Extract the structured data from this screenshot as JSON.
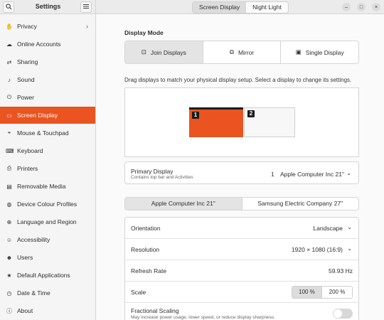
{
  "header": {
    "title": "Settings",
    "tabs": [
      {
        "label": "Screen Display",
        "active": true
      },
      {
        "label": "Night Light",
        "active": false
      }
    ],
    "search_icon": "search-icon",
    "menu_icon": "hamburger-icon",
    "window_controls": {
      "minimize": "–",
      "maximize": "□",
      "close": "×"
    }
  },
  "sidebar": {
    "items": [
      {
        "label": "Privacy",
        "icon": "hand-icon",
        "glyph": "✋",
        "chevron": true
      },
      {
        "label": "Online Accounts",
        "icon": "cloud-icon",
        "glyph": "☁"
      },
      {
        "label": "Sharing",
        "icon": "share-icon",
        "glyph": "⇄"
      },
      {
        "label": "Sound",
        "icon": "music-note-icon",
        "glyph": "♪"
      },
      {
        "label": "Power",
        "icon": "power-icon",
        "glyph": "⏻"
      },
      {
        "label": "Screen Display",
        "icon": "display-icon",
        "glyph": "▭",
        "active": true
      },
      {
        "label": "Mouse & Touchpad",
        "icon": "mouse-icon",
        "glyph": "⌖"
      },
      {
        "label": "Keyboard",
        "icon": "keyboard-icon",
        "glyph": "⌨"
      },
      {
        "label": "Printers",
        "icon": "printer-icon",
        "glyph": "⎙"
      },
      {
        "label": "Removable Media",
        "icon": "media-icon",
        "glyph": "▤"
      },
      {
        "label": "Device Colour Profiles",
        "icon": "color-profile-icon",
        "glyph": "◍"
      },
      {
        "label": "Language and Region",
        "icon": "globe-icon",
        "glyph": "⊕"
      },
      {
        "label": "Accessibility",
        "icon": "accessibility-icon",
        "glyph": "☺"
      },
      {
        "label": "Users",
        "icon": "users-icon",
        "glyph": "☻"
      },
      {
        "label": "Default Applications",
        "icon": "star-icon",
        "glyph": "★"
      },
      {
        "label": "Date & Time",
        "icon": "clock-icon",
        "glyph": "◷"
      },
      {
        "label": "About",
        "icon": "info-icon",
        "glyph": "ⓘ"
      }
    ]
  },
  "main": {
    "display_mode_title": "Display Mode",
    "modes": [
      {
        "label": "Join Displays",
        "icon": "join-displays-icon",
        "glyph": "⊡",
        "active": true
      },
      {
        "label": "Mirror",
        "icon": "mirror-icon",
        "glyph": "⧉",
        "active": false
      },
      {
        "label": "Single Display",
        "icon": "single-display-icon",
        "glyph": "▣",
        "active": false
      }
    ],
    "hint": "Drag displays to match your physical display setup. Select a display to change its settings.",
    "monitors": [
      {
        "number": "1",
        "selected": true
      },
      {
        "number": "2",
        "selected": false
      }
    ],
    "primary_display": {
      "title": "Primary Display",
      "subtitle": "Contains top bar and Activities",
      "number": "1",
      "value": "Apple Computer Inc 21\""
    },
    "display_tabs": [
      {
        "label": "Apple Computer Inc 21\"",
        "active": true
      },
      {
        "label": "Samsung Electric Company 27\"",
        "active": false
      }
    ],
    "settings": {
      "orientation": {
        "label": "Orientation",
        "value": "Landscape"
      },
      "resolution": {
        "label": "Resolution",
        "value": "1920 × 1080 (16:9)"
      },
      "refresh_rate": {
        "label": "Refresh Rate",
        "value": "59.93 Hz"
      },
      "scale": {
        "label": "Scale",
        "options": [
          "100 %",
          "200 %"
        ],
        "selected": "100 %"
      },
      "fractional_scaling": {
        "label": "Fractional Scaling",
        "subtitle": "May increase power usage, lower speed, or reduce display sharpness.",
        "enabled": false
      }
    }
  },
  "colors": {
    "accent": "#e95420",
    "sidebar_bg": "#f5f5f5",
    "header_bg": "#ebebeb"
  }
}
